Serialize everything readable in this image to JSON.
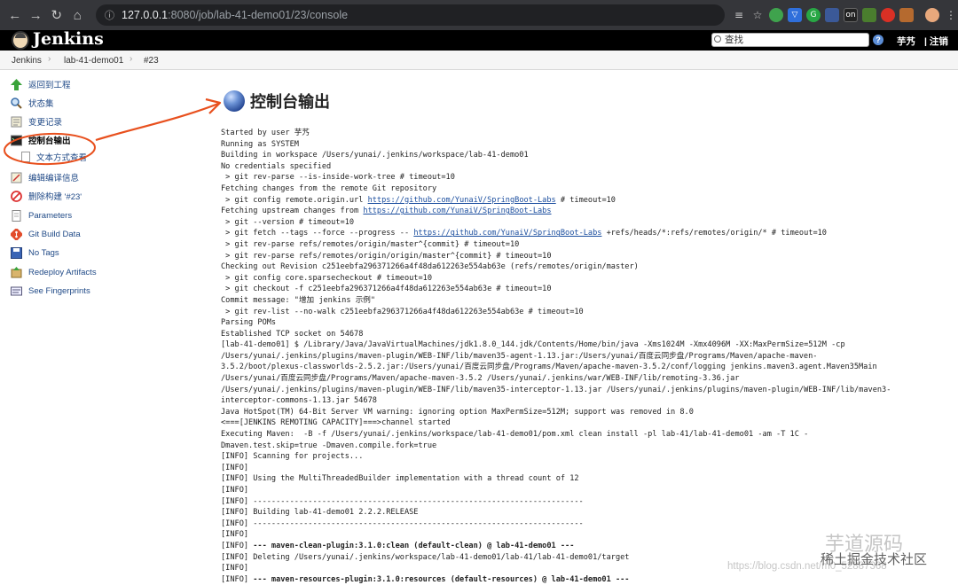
{
  "browser": {
    "url_host": "127.0.0.1",
    "url_path": ":8080/job/lab-41-demo01/23/console"
  },
  "header": {
    "title": "Jenkins",
    "search_placeholder": "查找",
    "help": "?",
    "user": "芋艿",
    "logout": "注销"
  },
  "breadcrumb": {
    "items": [
      "Jenkins",
      "lab-41-demo01",
      "#23"
    ],
    "sep": "›"
  },
  "sidebar": {
    "items": [
      {
        "label": "返回到工程",
        "icon": "up-arrow-icon"
      },
      {
        "label": "状态集",
        "icon": "magnifier-icon"
      },
      {
        "label": "变更记录",
        "icon": "notepad-icon"
      },
      {
        "label": "控制台输出",
        "icon": "terminal-icon"
      },
      {
        "label": "编辑编译信息",
        "icon": "notepad-edit-icon"
      },
      {
        "label": "删除构建 '#23'",
        "icon": "no-entry-icon"
      },
      {
        "label": "Parameters",
        "icon": "document-icon"
      },
      {
        "label": "Git Build Data",
        "icon": "git-icon"
      },
      {
        "label": "No Tags",
        "icon": "save-icon"
      },
      {
        "label": "Redeploy Artifacts",
        "icon": "redeploy-icon"
      },
      {
        "label": "See Fingerprints",
        "icon": "fingerprint-icon"
      }
    ],
    "sub_item": "文本方式查看"
  },
  "main": {
    "title": "控制台输出",
    "console_lines": [
      "Started by user 芋艿",
      "Running as SYSTEM",
      "Building in workspace /Users/yunai/.jenkins/workspace/lab-41-demo01",
      "No credentials specified",
      " > git rev-parse --is-inside-work-tree # timeout=10",
      "Fetching changes from the remote Git repository",
      " > git config remote.origin.url {link} # timeout=10",
      "Fetching upstream changes from {link}",
      " > git --version # timeout=10",
      " > git fetch --tags --force --progress -- {link} +refs/heads/*:refs/remotes/origin/* # timeout=10",
      " > git rev-parse refs/remotes/origin/master^{commit} # timeout=10",
      " > git rev-parse refs/remotes/origin/origin/master^{commit} # timeout=10",
      "Checking out Revision c251eebfa296371266a4f48da612263e554ab63e (refs/remotes/origin/master)",
      " > git config core.sparsecheckout # timeout=10",
      " > git checkout -f c251eebfa296371266a4f48da612263e554ab63e # timeout=10",
      "Commit message: \"增加 jenkins 示例\"",
      " > git rev-list --no-walk c251eebfa296371266a4f48da612263e554ab63e # timeout=10",
      "Parsing POMs",
      "Established TCP socket on 54678",
      "[lab-41-demo01] $ /Library/Java/JavaVirtualMachines/jdk1.8.0_144.jdk/Contents/Home/bin/java -Xms1024M -Xmx4096M -XX:MaxPermSize=512M -cp",
      "/Users/yunai/.jenkins/plugins/maven-plugin/WEB-INF/lib/maven35-agent-1.13.jar:/Users/yunai/百度云同步盘/Programs/Maven/apache-maven-",
      "3.5.2/boot/plexus-classworlds-2.5.2.jar:/Users/yunai/百度云同步盘/Programs/Maven/apache-maven-3.5.2/conf/logging jenkins.maven3.agent.Maven35Main",
      "/Users/yunai/百度云同步盘/Programs/Maven/apache-maven-3.5.2 /Users/yunai/.jenkins/war/WEB-INF/lib/remoting-3.36.jar",
      "/Users/yunai/.jenkins/plugins/maven-plugin/WEB-INF/lib/maven35-interceptor-1.13.jar /Users/yunai/.jenkins/plugins/maven-plugin/WEB-INF/lib/maven3-",
      "interceptor-commons-1.13.jar 54678",
      "Java HotSpot(TM) 64-Bit Server VM warning: ignoring option MaxPermSize=512M; support was removed in 8.0",
      "<===[JENKINS REMOTING CAPACITY]===>channel started",
      "Executing Maven:  -B -f /Users/yunai/.jenkins/workspace/lab-41-demo01/pom.xml clean install -pl lab-41/lab-41-demo01 -am -T 1C -",
      "Dmaven.test.skip=true -Dmaven.compile.fork=true",
      "[INFO] Scanning for projects...",
      "[INFO]",
      "[INFO] Using the MultiThreadedBuilder implementation with a thread count of 12",
      "[INFO]",
      "[INFO] ------------------------------------------------------------------------",
      "[INFO] Building lab-41-demo01 2.2.2.RELEASE",
      "[INFO] ------------------------------------------------------------------------",
      "[INFO]",
      "[INFO] {b}--- maven-clean-plugin:3.1.0:clean (default-clean) @ lab-41-demo01 ---{/b}",
      "[INFO] Deleting /Users/yunai/.jenkins/workspace/lab-41-demo01/lab-41/lab-41-demo01/target",
      "[INFO]",
      "[INFO] {b}--- maven-resources-plugin:3.1.0:resources (default-resources) @ lab-41-demo01 ---{/b}"
    ],
    "link": "https://github.com/YunaiV/SpringBoot-Labs"
  },
  "watermarks": {
    "wm1": "芋道源码",
    "wm2": "稀土掘金技术社区",
    "wm3": "https://blog.csdn.net/m0_52887368"
  },
  "colors": {
    "link": "#1a4d9e",
    "annotation": "#e8501e"
  }
}
